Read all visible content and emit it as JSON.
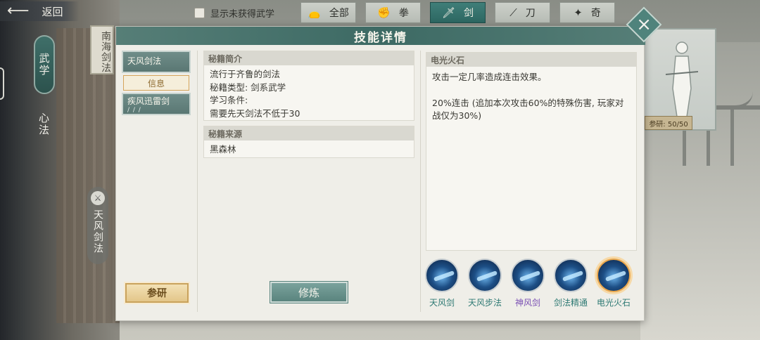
{
  "topbar": {
    "back_label": "返回",
    "show_unobtained_label": "显示未获得武学",
    "tabs": [
      {
        "label": "全部",
        "icon": "bag-icon"
      },
      {
        "label": "拳",
        "icon": "fist-icon"
      },
      {
        "label": "剑",
        "icon": "sword-icon"
      },
      {
        "label": "刀",
        "icon": "blade-icon"
      },
      {
        "label": "奇",
        "icon": "shuriken-icon"
      }
    ],
    "active_tab": "剑"
  },
  "side": {
    "wuxue": "武学",
    "xinfa": "心法",
    "banner_text": "南海剑法",
    "current_skill_vertical": "天风剑法"
  },
  "portrait": {
    "research_progress": "参研: 50/50"
  },
  "modal": {
    "title": "技能详情",
    "skills": [
      {
        "name": "天风剑法",
        "selected": true
      },
      {
        "name": "疾风迅雷剑",
        "ticks": "/ / /"
      }
    ],
    "info_tab": "信息",
    "research_button": "参研",
    "intro": {
      "heading": "秘籍简介",
      "lines": [
        "流行于齐鲁的剑法",
        "秘籍类型: 剑系武学",
        "学习条件:",
        "需要先天剑法不低于30"
      ]
    },
    "source": {
      "heading": "秘籍来源",
      "text": "黑森林"
    },
    "practice_button": "修炼",
    "detail": {
      "heading": "电光火石",
      "text1": "攻击一定几率造成连击效果。",
      "text2": "20%连击 (追加本次攻击60%的特殊伤害, 玩家对战仅为30%)"
    },
    "moves": [
      {
        "name": "天风剑",
        "color": "#2f7a74"
      },
      {
        "name": "天风步法",
        "color": "#2f7a74"
      },
      {
        "name": "神风剑",
        "color": "#7a4fb3"
      },
      {
        "name": "剑法精通",
        "color": "#2f7a74"
      },
      {
        "name": "电光火石",
        "color": "#2f7a74",
        "selected": true
      }
    ]
  }
}
